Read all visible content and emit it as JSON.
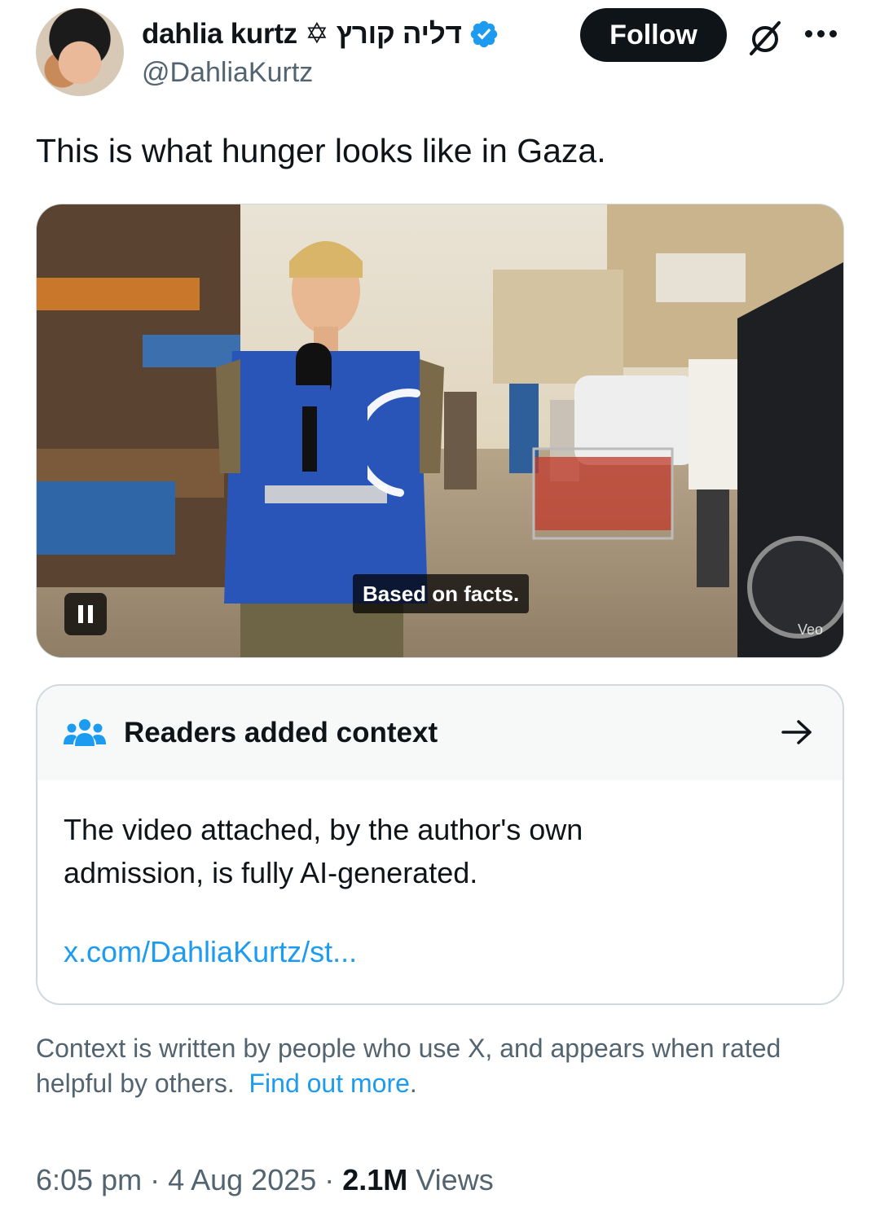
{
  "author": {
    "display_name": "dahlia kurtz ✡ דליה קורץ",
    "handle": "@DahliaKurtz",
    "verified": true
  },
  "actions": {
    "follow_label": "Follow"
  },
  "tweet": {
    "text": "This is what hunger looks like in Gaza."
  },
  "media": {
    "caption": "Based on facts.",
    "watermark": "Veo",
    "state": "playing"
  },
  "community_note": {
    "title": "Readers added context",
    "body": "The video attached, by the author's own admission, is fully AI-generated.",
    "link": "x.com/DahliaKurtz/st..."
  },
  "context_info": {
    "text": "Context is written by people who use X, and appears when rated helpful by others.",
    "link_label": "Find out more",
    "trailing": "."
  },
  "meta": {
    "time": "6:05 pm",
    "separator": " · ",
    "date": "4 Aug 2025",
    "views_count": "2.1M",
    "views_label": " Views"
  },
  "icons": {
    "verified": "verified-badge-icon",
    "grok": "grok-icon",
    "more": "more-icon",
    "people": "people-icon",
    "arrow": "arrow-right-icon",
    "pause": "pause-icon"
  },
  "colors": {
    "accent": "#1d9bf0",
    "text_primary": "#0f1419",
    "text_secondary": "#536471",
    "border": "#cfd9de",
    "note_header_bg": "#f7f9f9"
  }
}
